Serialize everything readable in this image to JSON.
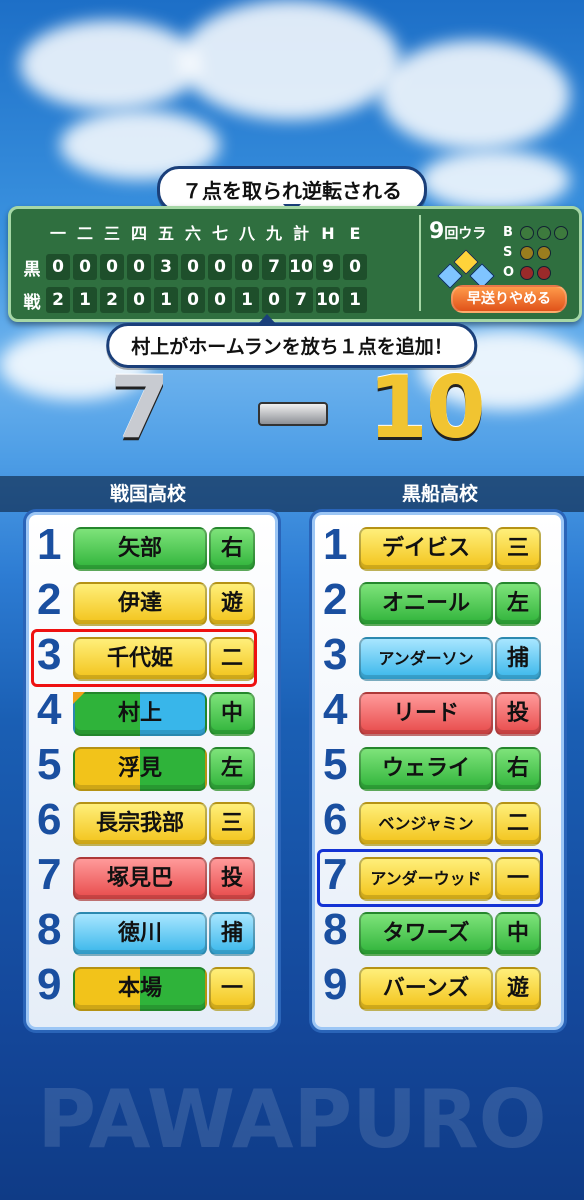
{
  "headline": "７点を取られ逆転される",
  "subline": "村上がホームランを放ち１点を追加！",
  "scoreboard": {
    "headers": [
      "一",
      "二",
      "三",
      "四",
      "五",
      "六",
      "七",
      "八",
      "九",
      "計",
      "H",
      "E"
    ],
    "rows": [
      {
        "team": "黒",
        "cells": [
          "0",
          "0",
          "0",
          "0",
          "3",
          "0",
          "0",
          "0",
          "7",
          "10",
          "9",
          "0"
        ]
      },
      {
        "team": "戦",
        "cells": [
          "2",
          "1",
          "2",
          "0",
          "1",
          "0",
          "0",
          "1",
          "0",
          "7",
          "10",
          "1"
        ]
      }
    ],
    "inning": "9",
    "inning_suffix": "回ウラ",
    "count_labels": [
      "B",
      "S",
      "O"
    ],
    "skip_button": "早送りやめる"
  },
  "score": {
    "left": "7",
    "right": "10"
  },
  "teams": {
    "left": "戦国高校",
    "right": "黒船高校"
  },
  "lineup_left": [
    {
      "num": "1",
      "name": "矢部",
      "pos": "右"
    },
    {
      "num": "2",
      "name": "伊達",
      "pos": "遊"
    },
    {
      "num": "3",
      "name": "千代姫",
      "pos": "二"
    },
    {
      "num": "4",
      "name": "村上",
      "pos": "中"
    },
    {
      "num": "5",
      "name": "浮見",
      "pos": "左"
    },
    {
      "num": "6",
      "name": "長宗我部",
      "pos": "三"
    },
    {
      "num": "7",
      "name": "塚見巴",
      "pos": "投"
    },
    {
      "num": "8",
      "name": "徳川",
      "pos": "捕"
    },
    {
      "num": "9",
      "name": "本場",
      "pos": "一"
    }
  ],
  "lineup_right": [
    {
      "num": "1",
      "name": "デイビス",
      "pos": "三"
    },
    {
      "num": "2",
      "name": "オニール",
      "pos": "左"
    },
    {
      "num": "3",
      "name": "アンダーソン",
      "pos": "捕"
    },
    {
      "num": "4",
      "name": "リード",
      "pos": "投"
    },
    {
      "num": "5",
      "name": "ウェライ",
      "pos": "右"
    },
    {
      "num": "6",
      "name": "ベンジャミン",
      "pos": "二"
    },
    {
      "num": "7",
      "name": "アンダーウッド",
      "pos": "一"
    },
    {
      "num": "8",
      "name": "タワーズ",
      "pos": "中"
    },
    {
      "num": "9",
      "name": "バーンズ",
      "pos": "遊"
    }
  ],
  "watermark": "PAWAPURO",
  "colors": {
    "board": "#2f6f3f",
    "accent_red": "#e11",
    "accent_blue": "#1433d4",
    "gold": "#f1c431"
  }
}
